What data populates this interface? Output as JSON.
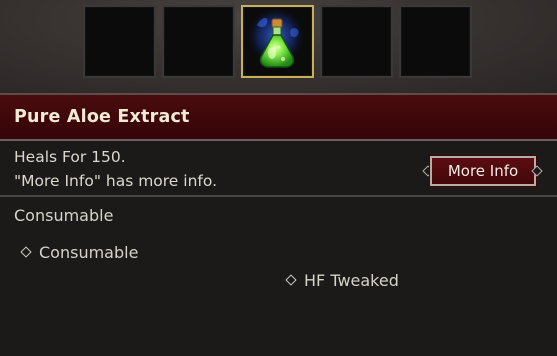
{
  "hotbar": {
    "slots": [
      {
        "item": null
      },
      {
        "item": null
      },
      {
        "item": "potion-icon",
        "selected": true
      },
      {
        "item": null
      },
      {
        "item": null
      }
    ]
  },
  "item": {
    "name": "Pure Aloe Extract",
    "description_line1": "Heals For 150.",
    "description_line2": "\"More Info\" has more info.",
    "type": "Consumable"
  },
  "actions": {
    "more_info_label": "More Info"
  },
  "properties": [
    {
      "label": "Consumable"
    },
    {
      "label": "HF Tweaked"
    }
  ],
  "colors": {
    "title_bg": "#3e0709",
    "selected_slot_border": "#c7b05a",
    "potion_liquid": "#6fe24a",
    "potion_glow": "#2a6cff"
  }
}
